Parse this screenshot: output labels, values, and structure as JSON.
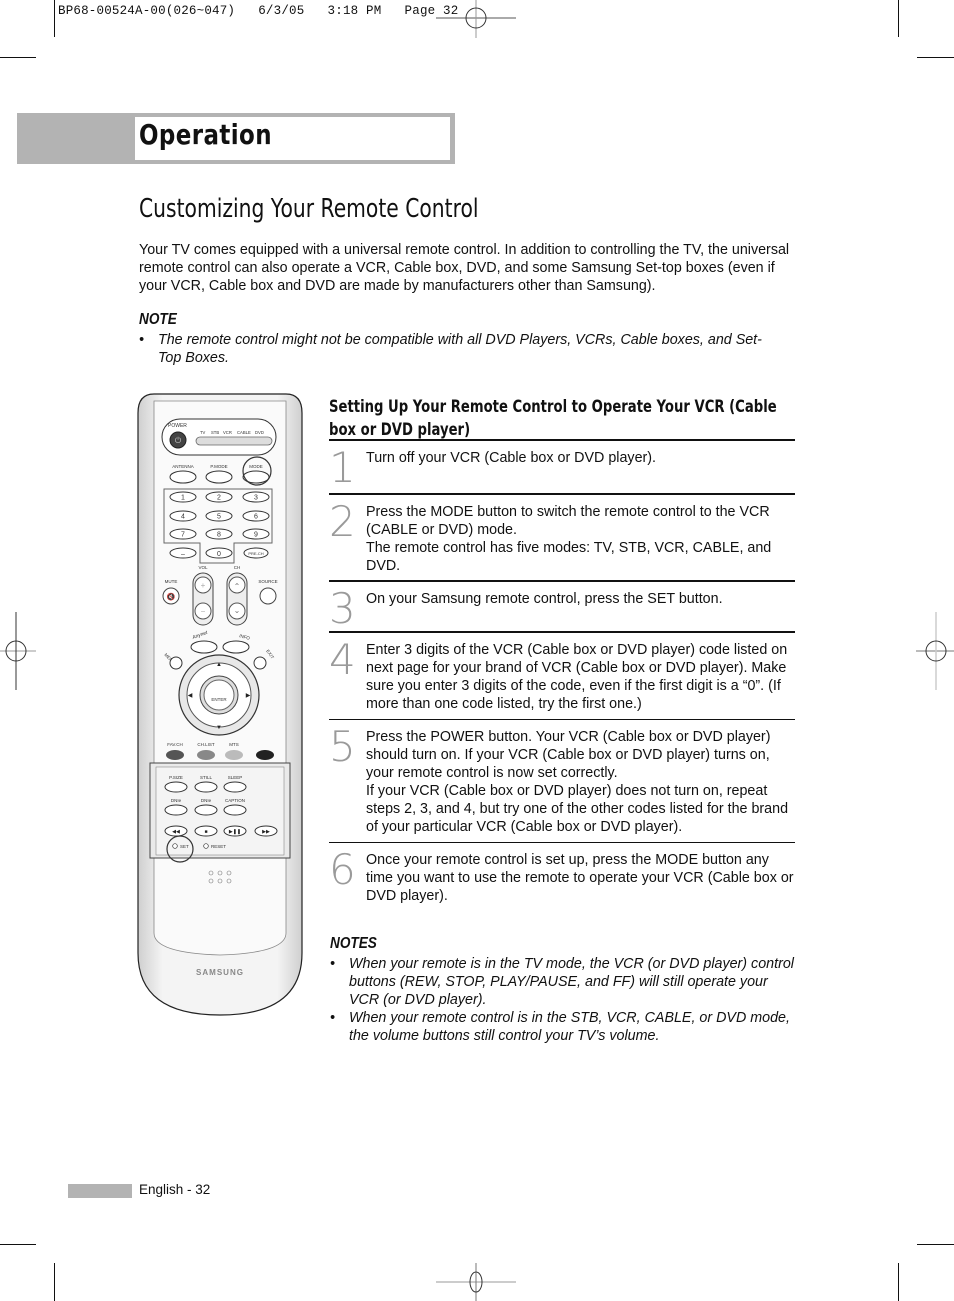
{
  "print_slug": "BP68-00524A-00(026~047)   6/3/05   3:18 PM   Page 32",
  "section_banner": "Operation",
  "page_title": "Customizing Your Remote Control",
  "intro": "Your TV comes equipped with a universal remote control. In addition to controlling the TV, the universal remote control can also operate a VCR, Cable box, DVD, and some Samsung Set-top boxes (even if your VCR, Cable box and DVD are made by manufacturers other than Samsung).",
  "note": {
    "heading": "NOTE",
    "items": [
      "The remote control might not be compatible with all DVD Players, VCRs, Cable boxes, and Set-Top Boxes."
    ]
  },
  "setup": {
    "heading": "Setting Up Your Remote Control to Operate Your VCR (Cable box or DVD player)",
    "steps": [
      {
        "num": "1",
        "lines": [
          "Turn off your VCR (Cable box or DVD player)."
        ]
      },
      {
        "num": "2",
        "lines": [
          "Press the MODE button to switch the remote control to the VCR (CABLE or DVD) mode.",
          "The remote control has five modes: TV, STB, VCR, CABLE, and DVD."
        ]
      },
      {
        "num": "3",
        "lines": [
          "On your Samsung remote control, press the SET button."
        ]
      },
      {
        "num": "4",
        "lines": [
          "Enter 3 digits of the VCR (Cable box or DVD player) code listed on next page for your brand of VCR (Cable box or DVD player). Make sure you enter 3 digits of the code, even if the first digit is a “0”. (If more than one code listed, try the first one.)"
        ]
      },
      {
        "num": "5",
        "lines": [
          "Press the POWER button. Your VCR (Cable box or DVD player) should turn on. If your VCR (Cable box or DVD player) turns on, your remote control is now set correctly.",
          "If your VCR (Cable box or DVD player) does not turn on, repeat steps 2, 3, and 4, but try one of the other codes listed for the brand of your particular VCR (Cable box or DVD player)."
        ]
      },
      {
        "num": "6",
        "lines": [
          "Once your remote control is set up, press the MODE button any time you want to use the remote to operate your VCR (Cable box or DVD player)."
        ]
      }
    ]
  },
  "notes": {
    "heading": "NOTES",
    "items": [
      "When your remote is in the TV mode, the VCR (or DVD player) control buttons (REW, STOP, PLAY/PAUSE, and FF) will still operate your VCR (or DVD player).",
      "When your remote control is in the STB, VCR, CABLE, or DVD mode, the volume buttons still control your TV’s volume."
    ]
  },
  "remote": {
    "power": "POWER",
    "modes": [
      "TV",
      "STB",
      "VCR",
      "CABLE",
      "DVD"
    ],
    "row1": [
      "ANTENNA",
      "P.MODE",
      "MODE"
    ],
    "digits": [
      "1",
      "2",
      "3",
      "4",
      "5",
      "6",
      "7",
      "8",
      "9"
    ],
    "dash": "–",
    "zero": "0",
    "prech": "PRE-CH",
    "vol": "VOL",
    "ch": "CH",
    "mute": "MUTE",
    "source": "SOURCE",
    "anynet": "Anynet",
    "info": "INFO",
    "menu": "MENU",
    "exit": "EXIT",
    "enter": "ENTER",
    "color_row": [
      "FAV.CH",
      "CH.LIST",
      "MTS"
    ],
    "row_a": [
      "P.SIZE",
      "STILL",
      "SLEEP"
    ],
    "row_b": [
      "DNIe",
      "DNIe",
      "CAPTION"
    ],
    "set": "SET",
    "reset": "RESET",
    "brand": "SAMSUNG",
    "highlighted": [
      "MODE",
      "SET"
    ]
  },
  "footer": {
    "page_label": "English - 32"
  }
}
